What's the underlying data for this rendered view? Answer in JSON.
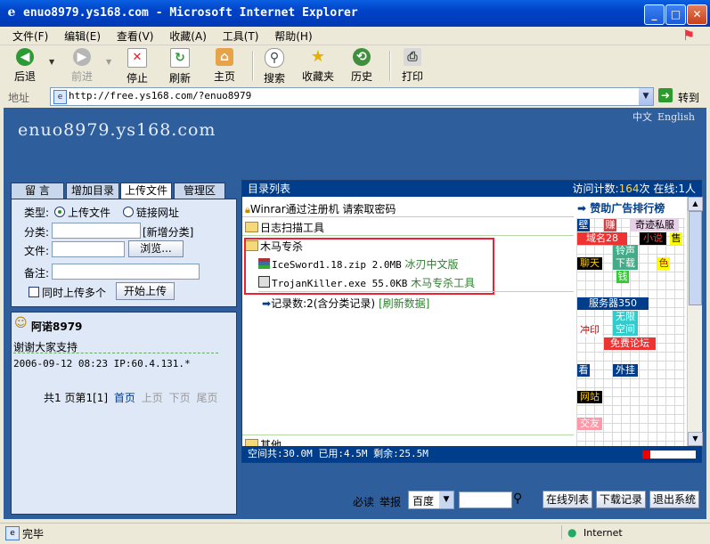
{
  "window": {
    "title": "enuo8979.ys168.com - Microsoft Internet Explorer",
    "controls": [
      "_",
      "□",
      "✕"
    ]
  },
  "menu": [
    "文件(F)",
    "编辑(E)",
    "查看(V)",
    "收藏(A)",
    "工具(T)",
    "帮助(H)"
  ],
  "toolbar": {
    "back": "后退",
    "forward": "前进",
    "stop": "停止",
    "refresh": "刷新",
    "home": "主页",
    "search": "搜索",
    "favorites": "收藏夹",
    "history": "历史",
    "print": "打印"
  },
  "address": {
    "label": "地址",
    "url": "http://free.ys168.com/?enuo8979",
    "go": "转到"
  },
  "site": {
    "title": "enuo8979.ys168.com",
    "lang": [
      "中文",
      "English"
    ]
  },
  "left": {
    "tabs": [
      "留 言",
      "增加目录",
      "上传文件",
      "管理区"
    ],
    "form": {
      "type_label": "类型:",
      "opt_upload": "上传文件",
      "opt_link": "链接网址",
      "category_label": "分类:",
      "new_category": "[新增分类]",
      "file_label": "文件:",
      "browse": "浏览...",
      "note_label": "备注:",
      "multi": "同时上传多个",
      "start": "开始上传"
    },
    "message": {
      "author": "阿诺8979",
      "text": "谢谢大家支持",
      "meta": "2006-09-12 08:23 IP:60.4.131.*",
      "pager": {
        "total": "共1 页第1[1]",
        "first": "首页",
        "prev": "上页",
        "next": "下页",
        "last": "尾页"
      }
    }
  },
  "right": {
    "header_left": "目录列表",
    "visits_label": "访问计数:",
    "visits": "164",
    "visits_unit": "次",
    "online": "在线:1人",
    "items": {
      "lock_item": "Winrar通过注册机 请索取密码",
      "folder1": "日志扫描工具",
      "folder2": "木马专杀",
      "file1_name": "IceSword1.18.zip 2.0MB",
      "file1_desc": "冰刃中文版",
      "file2_name": "TrojanKiller.exe 55.0KB",
      "file2_desc": "木马专杀工具",
      "records": "记录数:2(含分类记录)",
      "refresh": "[刷新数据]",
      "folder3": "其他"
    },
    "ads": {
      "title": "赞助广告排行榜",
      "a1": "壁",
      "a2": "赚",
      "a3": "奇迹私服",
      "a4": "域名28",
      "a5": "小说",
      "a6": "售",
      "a7": "铃声下载",
      "a8": "聊天",
      "a9": "色",
      "a10": "钱",
      "a11": "服务器350",
      "a12": "无限空间",
      "a13": "冲印",
      "a14": "免费论坛",
      "a15": "看",
      "a16": "外挂",
      "a17": "网站",
      "a18": "交友"
    },
    "footer": "空间共:30.0M 已用:4.5M 剩余:25.5M",
    "usage_fraction": 0.15
  },
  "bottom": {
    "must_read": "必读",
    "report": "举报",
    "engine": "百度",
    "online_list": "在线列表",
    "download_log": "下载记录",
    "logout": "退出系统"
  },
  "status": {
    "text": "完毕",
    "zone": "Internet"
  }
}
